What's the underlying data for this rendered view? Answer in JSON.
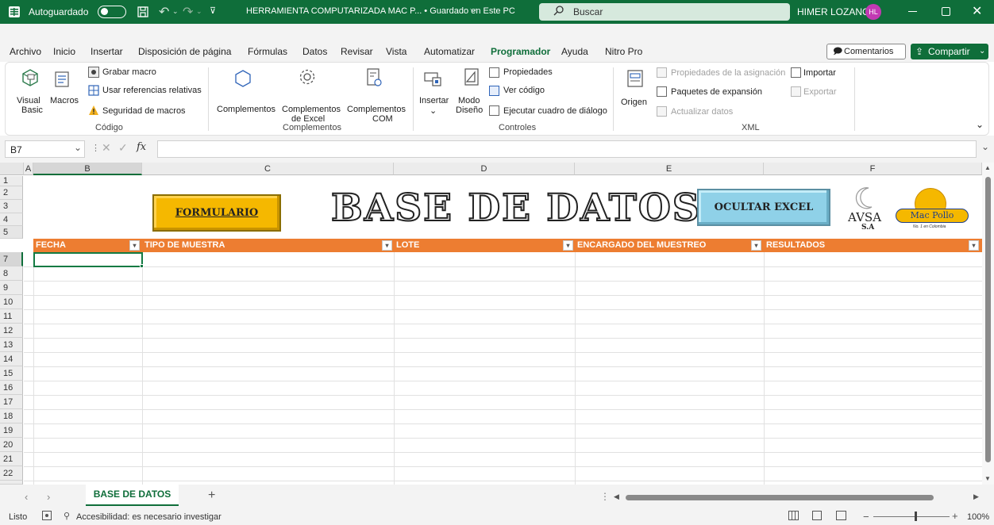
{
  "titlebar": {
    "autosave_label": "Autoguardado",
    "doc_title": "HERRAMIENTA COMPUTARIZADA MAC P... • Guardado en Este PC",
    "search_placeholder": "Buscar",
    "user_name": "HIMER LOZANO",
    "user_initials": "HL",
    "accent": "#0f6e3a",
    "avatar_color": "#c239b3"
  },
  "tabs": [
    "Archivo",
    "Inicio",
    "Insertar",
    "Disposición de página",
    "Fórmulas",
    "Datos",
    "Revisar",
    "Vista",
    "Automatizar",
    "Programador",
    "Ayuda",
    "Nitro Pro"
  ],
  "active_tab": "Programador",
  "header_buttons": {
    "comments": "Comentarios",
    "share": "Compartir"
  },
  "ribbon": {
    "codigo": {
      "visual_basic_1": "Visual",
      "visual_basic_2": "Basic",
      "macros": "Macros",
      "grabar": "Grabar macro",
      "referencias": "Usar referencias relativas",
      "seguridad": "Seguridad de macros",
      "group": "Código"
    },
    "complementos": {
      "complementos": "Complementos",
      "excel_1": "Complementos",
      "excel_2": "de Excel",
      "com_1": "Complementos",
      "com_2": "COM",
      "group": "Complementos"
    },
    "controles": {
      "insertar": "Insertar",
      "modo_1": "Modo",
      "modo_2": "Diseño",
      "propiedades": "Propiedades",
      "ver_codigo": "Ver código",
      "ejecutar": "Ejecutar cuadro de diálogo",
      "group": "Controles"
    },
    "xml": {
      "origen": "Origen",
      "prop_asignacion": "Propiedades de la asignación",
      "paquetes": "Paquetes de expansión",
      "actualizar": "Actualizar datos",
      "importar": "Importar",
      "exportar": "Exportar",
      "group": "XML"
    }
  },
  "formula_bar": {
    "name_box": "B7",
    "fx": "fx",
    "value": ""
  },
  "columns": [
    "A",
    "B",
    "C",
    "D",
    "E",
    "F"
  ],
  "rows": [
    "1",
    "2",
    "3",
    "4",
    "5",
    "7",
    "8",
    "9",
    "10",
    "11",
    "12",
    "13",
    "14",
    "15",
    "16",
    "17",
    "18",
    "19",
    "20",
    "21",
    "22"
  ],
  "sheet": {
    "title": "BASE DE DATOS",
    "formulario_button": "FORMULARIO",
    "ocultar_button": "OCULTAR EXCEL",
    "logo_avsa": "AVSA",
    "logo_sa": "S.A",
    "logo_macpollo": "Mac Pollo",
    "logo_tagline": "No. 1 en Colombia",
    "table_headers": [
      "FECHA",
      "TIPO DE  MUESTRA",
      "LOTE",
      "ENCARGADO DEL MUESTREO",
      "RESULTADOS"
    ],
    "header_color": "#ed7d31"
  },
  "sheet_tabs": {
    "active": "BASE DE DATOS"
  },
  "status": {
    "ready": "Listo",
    "accessibility": "Accesibilidad: es necesario investigar",
    "zoom": "100%"
  }
}
